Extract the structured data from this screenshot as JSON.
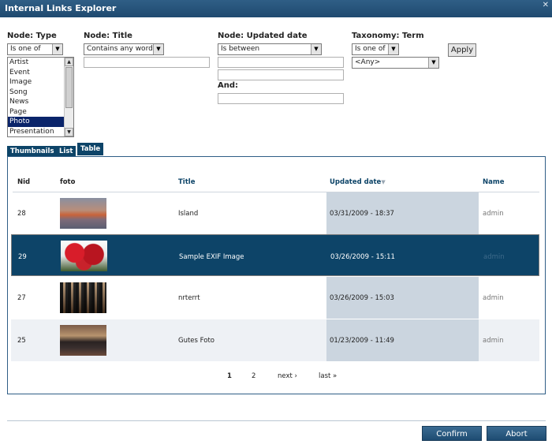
{
  "window": {
    "title": "Internal Links Explorer"
  },
  "filters": {
    "type": {
      "label": "Node: Type",
      "operator": "Is one of",
      "options": [
        "Artist",
        "Event",
        "Image",
        "Song",
        "News",
        "Page",
        "Photo",
        "Presentation"
      ],
      "selected": "Photo"
    },
    "title": {
      "label": "Node: Title",
      "operator": "Contains any word",
      "value": ""
    },
    "updated": {
      "label": "Node: Updated date",
      "operator": "Is between",
      "and_label": "And:"
    },
    "taxonomy": {
      "label": "Taxonomy: Term",
      "operator": "Is one of",
      "value": "<Any>"
    },
    "apply_label": "Apply"
  },
  "view_tabs": [
    {
      "label": "Thumbnails"
    },
    {
      "label": "List"
    },
    {
      "label": "Table"
    }
  ],
  "table": {
    "columns": [
      "Nid",
      "foto",
      "Title",
      "Updated date",
      "Name"
    ],
    "sort_indicator": "▼",
    "rows": [
      {
        "nid": "28",
        "title": "Island",
        "updated": "03/31/2009 - 18:37",
        "name": "admin"
      },
      {
        "nid": "29",
        "title": "Sample EXIF Image",
        "updated": "03/26/2009 - 15:11",
        "name": "admin"
      },
      {
        "nid": "27",
        "title": "nrterrt",
        "updated": "03/26/2009 - 15:03",
        "name": "admin"
      },
      {
        "nid": "25",
        "title": "Gutes Foto",
        "updated": "01/23/2009 - 11:49",
        "name": "admin"
      }
    ]
  },
  "pager": {
    "current": "1",
    "page2": "2",
    "next": "next ›",
    "last": "last »"
  },
  "footer": {
    "confirm": "Confirm",
    "abort": "Abort"
  },
  "icons": {
    "close": "close-icon",
    "dropdown": "chevron-down-icon",
    "sort": "sort-desc-icon"
  },
  "colors": {
    "titlebar": "#1f4a70",
    "selected_row": "#0d4468",
    "date_column": "#cbd5df"
  }
}
